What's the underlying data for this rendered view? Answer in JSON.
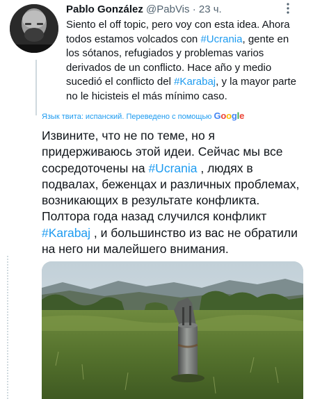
{
  "tweet": {
    "author_name": "Pablo González",
    "author_handle": "@PabVis",
    "separator": "·",
    "time": "23 ч.",
    "more_icon": "more-vertical-icon",
    "original_text": {
      "p1": "Siento el off topic, pero voy con esta idea. Ahora todos estamos volcados con ",
      "tag1": "#Ucrania",
      "p2": ", gente en los sótanos, refugiados y problemas varios derivados de un conflicto. Hace año y medio sucedió el conflicto del ",
      "tag2": "#Karabaj",
      "p3": ", y la mayor parte no le hicisteis el más mínimo caso."
    },
    "translation_note": "Язык твита: испанский. Переведено с помощью",
    "translation_provider": "Google",
    "translated_text": {
      "p1": "Извините, что не по теме, но я придерживаюсь этой идеи. Сейчас мы все сосредоточены на ",
      "tag1": "#Ucrania",
      "p2": " , людях в подвалах, беженцах и различных проблемах, возникающих в результате конфликта. Полтора года назад случился конфликт ",
      "tag2": "#Karabaj",
      "p3": " , и большинство из вас не обратили на него ни малейшего внимания."
    }
  },
  "colors": {
    "text": "#0f1419",
    "secondary": "#536471",
    "link": "#1d9bf0",
    "thread_line": "#cfd9de"
  }
}
